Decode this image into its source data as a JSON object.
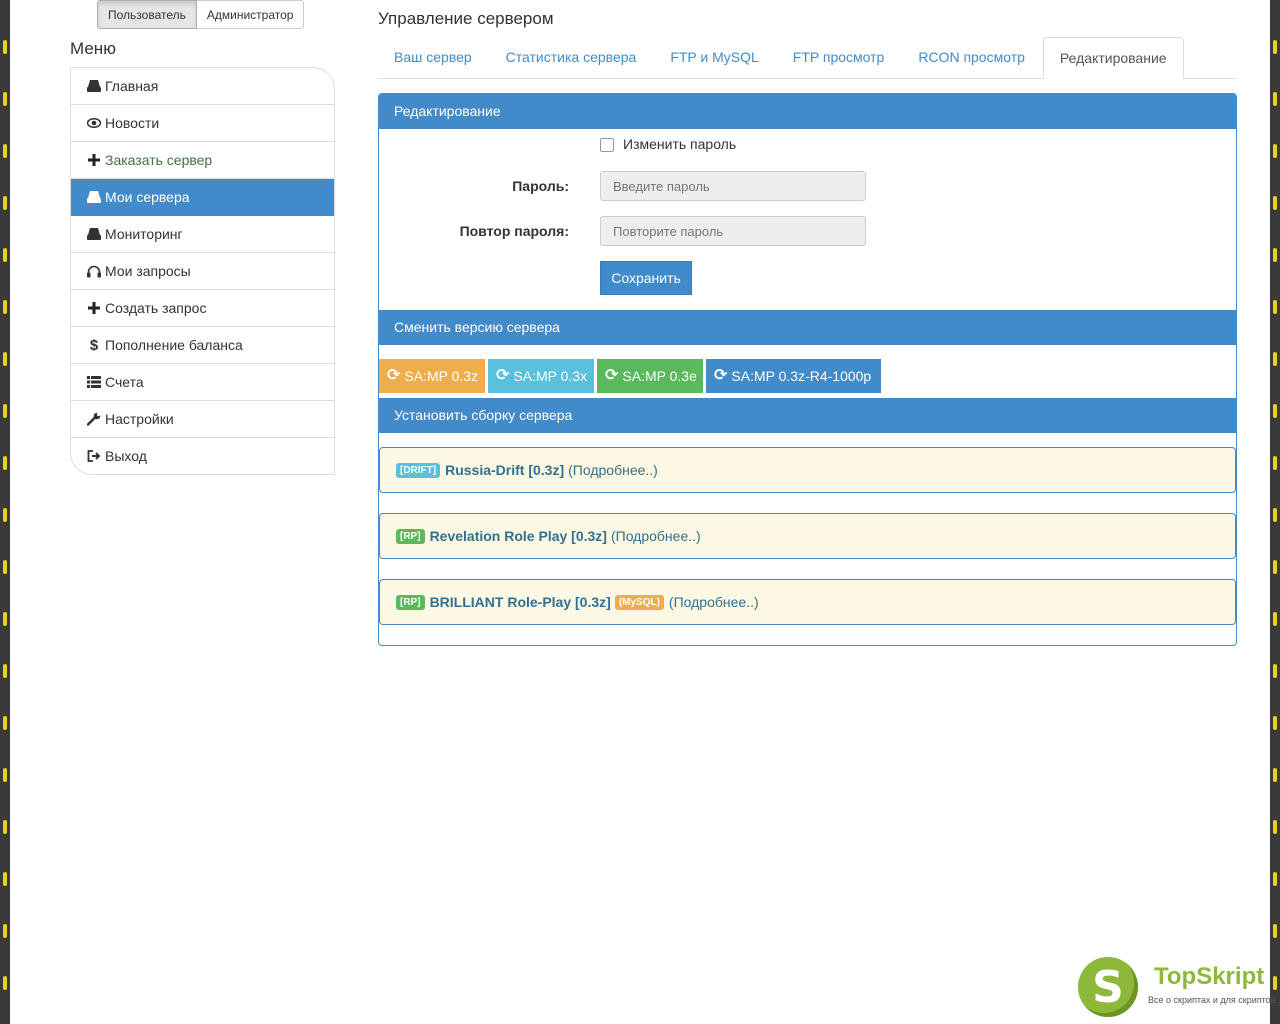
{
  "role_switch": {
    "user": "Пользователь",
    "admin": "Администратор"
  },
  "sidebar": {
    "title": "Меню",
    "items": [
      {
        "label": "Главная",
        "icon": "hdd-icon"
      },
      {
        "label": "Новости",
        "icon": "eye-icon"
      },
      {
        "label": "Заказать сервер",
        "icon": "plus-icon"
      },
      {
        "label": "Мои сервера",
        "icon": "hdd-icon"
      },
      {
        "label": "Мониторинг",
        "icon": "hdd-icon"
      },
      {
        "label": "Мои запросы",
        "icon": "headphones-icon"
      },
      {
        "label": "Создать запрос",
        "icon": "plus-icon"
      },
      {
        "label": "Пополнение баланса",
        "icon": "dollar-icon"
      },
      {
        "label": "Счета",
        "icon": "list-icon"
      },
      {
        "label": "Настройки",
        "icon": "wrench-icon"
      },
      {
        "label": "Выход",
        "icon": "logout-icon"
      }
    ]
  },
  "main": {
    "title": "Управление сервером",
    "tabs": [
      "Ваш сервер",
      "Статистика сервера",
      "FTP и MySQL",
      "FTP просмотр",
      "RCON просмотр",
      "Редактирование"
    ],
    "edit": {
      "header": "Редактирование",
      "change_password": "Изменить пароль",
      "password_label": "Пароль:",
      "password_placeholder": "Введите пароль",
      "repeat_label": "Повтор пароля:",
      "repeat_placeholder": "Повторите пароль",
      "save": "Сохранить"
    },
    "version": {
      "header": "Сменить версию сервера",
      "buttons": [
        {
          "label": "SA:MP 0.3z",
          "color": "#f0ad4e"
        },
        {
          "label": "SA:MP 0.3x",
          "color": "#5bc0de"
        },
        {
          "label": "SA:MP 0.3e",
          "color": "#5cb85c"
        },
        {
          "label": "SA:MP 0.3z-R4-1000p",
          "color": "#428bca"
        }
      ]
    },
    "builds": {
      "header": "Установить сборку сервера",
      "items": [
        {
          "badge": "[DRIFT]",
          "badge_color": "#5bc0de",
          "name": "Russia-Drift [0.3z]",
          "extra": "",
          "more": "(Подробнее..)"
        },
        {
          "badge": "[RP]",
          "badge_color": "#5cb85c",
          "name": "Revelation Role Play [0.3z]",
          "extra": "",
          "more": "(Подробнее..)"
        },
        {
          "badge": "[RP]",
          "badge_color": "#5cb85c",
          "name": "BRILLIANT Role-Play [0.3z]",
          "extra": "(MySQL)",
          "extra_color": "#f0ad4e",
          "more": "(Подробнее..)"
        }
      ]
    }
  },
  "watermark": {
    "letter": "S",
    "name": "TopSkript",
    "tagline": "Все о скриптах и для скриптов..."
  }
}
